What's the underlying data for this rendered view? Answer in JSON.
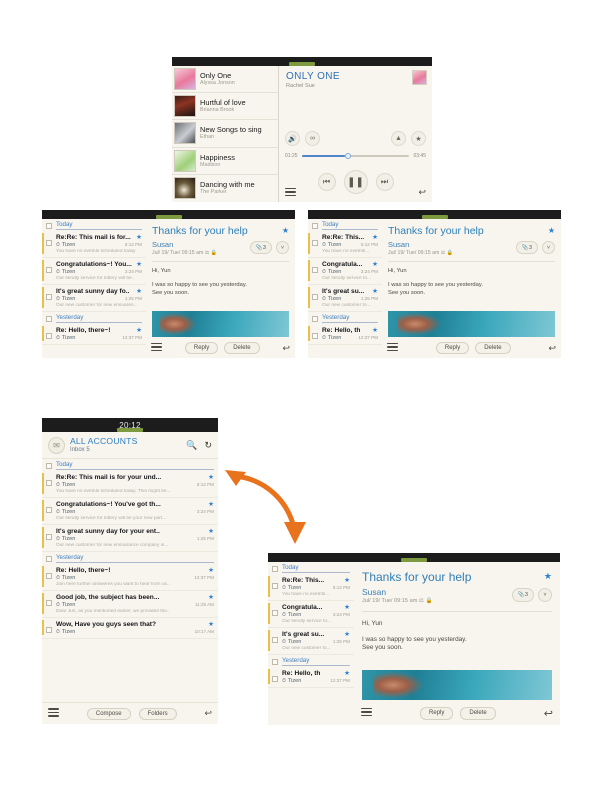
{
  "music_player": {
    "now_playing": {
      "title": "ONLY ONE",
      "artist": "Rachel Sue"
    },
    "elapsed": "01:25",
    "duration": "03:45",
    "progress_percent": 40,
    "controls": {
      "volume": "volume-icon",
      "shuffle": "shuffle-icon",
      "repeat": "repeat-icon",
      "favorite": "star-icon",
      "previous": "⏮",
      "play_pause": "⏸",
      "next": "⏭",
      "menu": "hamburger-icon",
      "back": "↩"
    },
    "tracks": [
      {
        "title": "Only One",
        "artist": "Alyssa Jonson",
        "art": "#f3a7bb"
      },
      {
        "title": "Hurtful of love",
        "artist": "Brianna Brook",
        "art": "#2a1a16"
      },
      {
        "title": "New Songs to sing",
        "artist": "Ethan",
        "art": "#8e9198"
      },
      {
        "title": "Happiness",
        "artist": "Madison",
        "art": "#cfe3b4"
      },
      {
        "title": "Dancing with me",
        "artist": "The Parker",
        "art": "#3b2f22"
      }
    ]
  },
  "mail": {
    "account_title": "ALL ACCOUNTS",
    "inbox_label": "Inbox 5",
    "status_time": "20:12",
    "search_icon": "search-icon",
    "refresh_icon": "refresh-icon",
    "group_today": "Today",
    "group_yesterday": "Yesterday",
    "sender": "Tizen",
    "bottom": {
      "compose": "Compose",
      "folders": "Folders",
      "back": "↩",
      "menu": "hamburger-icon"
    },
    "messages_full": [
      {
        "subject": "Re:Re: This mail is for your und...",
        "from": "Tizen",
        "time": "5:12 PM",
        "preview": "You have no evetnts scheduled today. This might be..."
      },
      {
        "subject": "Congratulations~! You've got th...",
        "from": "Tizen",
        "time": "3:24 PM",
        "preview": "Our fiendly service for lottery will be your new part..."
      },
      {
        "subject": "It's great sunny day for your ent..",
        "from": "Tizen",
        "time": "1:25 PM",
        "preview": "Our new customer for new ensuarance company is..."
      },
      {
        "subject": "Re: Hello, there~!",
        "from": "Tizen",
        "time": "12:37 PM",
        "preview": "Join here further answeres you want to hear from us.."
      },
      {
        "subject": "Good job, the subject has been...",
        "from": "Tizen",
        "time": "11:25 AM",
        "preview": "Dear Jun, as you mentioned earlier, we provided the.."
      },
      {
        "subject": "Wow, Have you guys seen that?",
        "from": "Tizen",
        "time": "10:17 AM",
        "preview": ""
      }
    ],
    "messages_medium": [
      {
        "subject": "Re:Re: This mail is for...",
        "from": "Tizen",
        "time": "5:12 PM",
        "preview": "You have no evetnts scheduled today"
      },
      {
        "subject": "Congratulations~! You...",
        "from": "Tizen",
        "time": "3:24 PM",
        "preview": "Our fiendly service for lottery will be.."
      },
      {
        "subject": "It's great sunny day fo..",
        "from": "Tizen",
        "time": "1:25 PM",
        "preview": "Our new customer for new ensuaren..."
      },
      {
        "subject": "Re: Hello, there~!",
        "from": "Tizen",
        "time": "12:37 PM",
        "preview": ""
      }
    ],
    "messages_narrow": [
      {
        "subject": "Re:Re: This...",
        "from": "Tizen",
        "time": "5:12 PM",
        "preview": "You have no evetnts..."
      },
      {
        "subject": "Congratula...",
        "from": "Tizen",
        "time": "3:24 PM",
        "preview": "Our fiendly service fo..."
      },
      {
        "subject": "It's great su...",
        "from": "Tizen",
        "time": "1:25 PM",
        "preview": "Our new customer fo..."
      },
      {
        "subject": "Re: Hello, th",
        "from": "Tizen",
        "time": "12:37 PM",
        "preview": ""
      }
    ],
    "detail": {
      "title": "Thanks for your help",
      "sender": "Susan",
      "date": "Jul/ 19/ Tue/ 09:15 am",
      "attachment_count": "3",
      "attachment_icon": "paperclip-icon",
      "expand_icon": "chevron-down-icon",
      "priority_icon": "priority-icon",
      "lock_icon": "lock-icon",
      "star_icon": "star-icon",
      "greeting": "Hi, Yun",
      "body_line1": "I was so happy to see you yesterday.",
      "body_line2": "See you soon.",
      "reply": "Reply",
      "delete": "Delete",
      "back": "↩",
      "menu": "hamburger-icon"
    }
  },
  "annotation": {
    "arrow": "curved-double-arrow",
    "color": "#e8731c"
  },
  "colors": {
    "accent_blue": "#2f7fc6",
    "panel_bg": "#f7f5ee",
    "statusbar": "#1c1c1c",
    "grip_green": "#7d9a3f",
    "unread_bar": "#e8c14a",
    "star": "#2f7fd0"
  }
}
